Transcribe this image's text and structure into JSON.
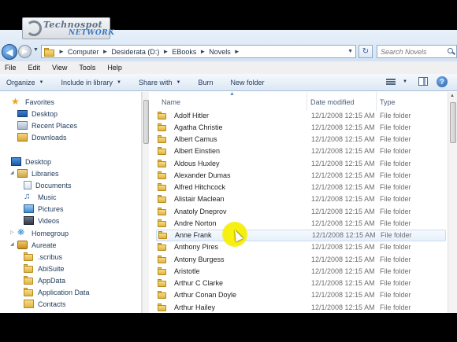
{
  "logo": {
    "line1": "Technospot",
    "line2": "NETWORK"
  },
  "address": {
    "crumbs": [
      "Computer",
      "Desiderata (D:)",
      "EBooks",
      "Novels"
    ]
  },
  "search": {
    "placeholder": "Search Novels"
  },
  "menu": [
    "File",
    "Edit",
    "View",
    "Tools",
    "Help"
  ],
  "commands": {
    "organize": "Organize",
    "include": "Include in library",
    "share": "Share with",
    "burn": "Burn",
    "new_folder": "New folder"
  },
  "nav": {
    "favorites": "Favorites",
    "desktop": "Desktop",
    "recent": "Recent Places",
    "downloads": "Downloads",
    "desktop_root": "Desktop",
    "libraries": "Libraries",
    "documents": "Documents",
    "music": "Music",
    "pictures": "Pictures",
    "videos": "Videos",
    "homegroup": "Homegroup",
    "user": "Aureate",
    "scribus": ".scribus",
    "abisuite": "AbiSuite",
    "appdata": "AppData",
    "appdata2": "Application Data",
    "contacts": "Contacts"
  },
  "columns": {
    "name": "Name",
    "date": "Date modified",
    "type": "Type"
  },
  "files": [
    {
      "name": "Adolf Hitler",
      "date": "12/1/2008 12:15 AM",
      "type": "File folder"
    },
    {
      "name": "Agatha Christie",
      "date": "12/1/2008 12:15 AM",
      "type": "File folder"
    },
    {
      "name": "Albert Camus",
      "date": "12/1/2008 12:15 AM",
      "type": "File folder"
    },
    {
      "name": "Albert Einstien",
      "date": "12/1/2008 12:15 AM",
      "type": "File folder"
    },
    {
      "name": "Aldous Huxley",
      "date": "12/1/2008 12:15 AM",
      "type": "File folder"
    },
    {
      "name": "Alexander Dumas",
      "date": "12/1/2008 12:15 AM",
      "type": "File folder"
    },
    {
      "name": "Alfred Hitchcock",
      "date": "12/1/2008 12:15 AM",
      "type": "File folder"
    },
    {
      "name": "Alistair Maclean",
      "date": "12/1/2008 12:15 AM",
      "type": "File folder"
    },
    {
      "name": "Anatoly Dneprov",
      "date": "12/1/2008 12:15 AM",
      "type": "File folder"
    },
    {
      "name": "Andre Norton",
      "date": "12/1/2008 12:15 AM",
      "type": "File folder"
    },
    {
      "name": "Anne Frank",
      "date": "12/1/2008 12:15 AM",
      "type": "File folder"
    },
    {
      "name": "Anthony Pires",
      "date": "12/1/2008 12:15 AM",
      "type": "File folder"
    },
    {
      "name": "Antony Burgess",
      "date": "12/1/2008 12:15 AM",
      "type": "File folder"
    },
    {
      "name": "Aristotle",
      "date": "12/1/2008 12:15 AM",
      "type": "File folder"
    },
    {
      "name": "Arthur C Clarke",
      "date": "12/1/2008 12:15 AM",
      "type": "File folder"
    },
    {
      "name": "Arthur Conan Doyle",
      "date": "12/1/2008 12:15 AM",
      "type": "File folder"
    },
    {
      "name": "Arthur Hailey",
      "date": "12/1/2008 12:15 AM",
      "type": "File folder"
    }
  ]
}
